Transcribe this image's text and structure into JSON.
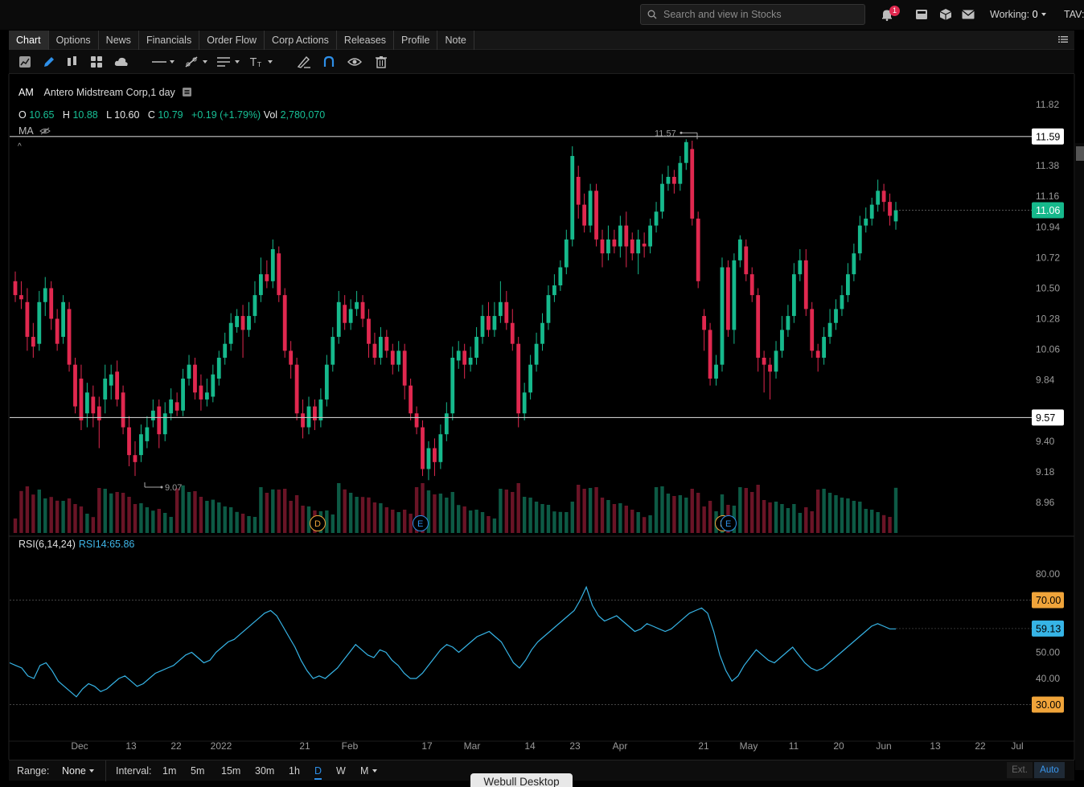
{
  "topbar": {
    "search_placeholder": "Search and view in Stocks",
    "notification_count": "1",
    "working_label": "Working:",
    "working_value": "0",
    "account_label": "TAV:"
  },
  "tabs": [
    {
      "label": "Chart",
      "active": true
    },
    {
      "label": "Options"
    },
    {
      "label": "News"
    },
    {
      "label": "Financials"
    },
    {
      "label": "Order Flow"
    },
    {
      "label": "Corp Actions"
    },
    {
      "label": "Releases"
    },
    {
      "label": "Profile"
    },
    {
      "label": "Note"
    }
  ],
  "legend": {
    "symbol": "AM",
    "name": "Antero Midstream Corp,1 day",
    "open_label": "O",
    "open": "10.65",
    "high_label": "H",
    "high": "10.88",
    "low_label": "L",
    "low": "10.60",
    "close_label": "C",
    "close": "10.79",
    "change": "+0.19 (+1.79%)",
    "vol_label": "Vol",
    "volume": "2,780,070",
    "ma_label": "MA",
    "rsi_label": "RSI(6,14,24)",
    "rsi_value": "RSI14:65.86"
  },
  "colors": {
    "up": "#16b98c",
    "down": "#e0284f",
    "rsi_line": "#36b4e6",
    "accent_blue": "#2e8fe8",
    "badge_orange": "#f0a43a"
  },
  "bottom": {
    "range_label": "Range:",
    "range_value": "None",
    "interval_label": "Interval:",
    "intervals": [
      "1m",
      "5m",
      "15m",
      "30m",
      "1h",
      "D",
      "W",
      "M"
    ],
    "active_interval": "D",
    "ext_label": "Ext.",
    "auto_label": "Auto"
  },
  "tooltip": "Webull Desktop",
  "chart_data": {
    "type": "candlestick",
    "price_axis": [
      "11.82",
      "11.38",
      "11.16",
      "10.94",
      "10.72",
      "10.50",
      "10.28",
      "10.06",
      "9.84",
      "9.40",
      "9.18",
      "8.96"
    ],
    "price_range": [
      8.88,
      11.9
    ],
    "horizontal_lines": [
      {
        "value": 11.59,
        "label": "11.59"
      },
      {
        "value": 9.57,
        "label": "9.57"
      }
    ],
    "last_price": {
      "value": 11.06,
      "label": "11.06"
    },
    "annotations": [
      {
        "value": 11.57,
        "label": "11.57"
      },
      {
        "value": 9.07,
        "label": "9.07"
      }
    ],
    "events": [
      "D",
      "E",
      "D",
      "E"
    ],
    "x_axis": [
      "Dec",
      "13",
      "22",
      "2022",
      "21",
      "Feb",
      "17",
      "Mar",
      "14",
      "23",
      "Apr",
      "21",
      "May",
      "11",
      "20",
      "Jun",
      "13",
      "22",
      "Jul"
    ],
    "candles": [
      [
        10.55,
        10.45,
        10.62,
        10.4
      ],
      [
        10.45,
        10.42,
        10.55,
        10.35
      ],
      [
        10.4,
        10.15,
        10.5,
        10.05
      ],
      [
        10.15,
        10.08,
        10.25,
        10.0
      ],
      [
        10.1,
        10.4,
        10.48,
        10.05
      ],
      [
        10.4,
        10.5,
        10.58,
        10.3
      ],
      [
        10.5,
        10.28,
        10.55,
        10.2
      ],
      [
        10.28,
        10.1,
        10.35,
        10.05
      ],
      [
        10.15,
        10.4,
        10.45,
        10.1
      ],
      [
        10.35,
        9.95,
        10.4,
        9.9
      ],
      [
        9.95,
        9.65,
        10.0,
        9.6
      ],
      [
        9.85,
        9.55,
        9.95,
        9.48
      ],
      [
        9.6,
        9.75,
        9.82,
        9.5
      ],
      [
        9.72,
        9.6,
        9.8,
        9.5
      ],
      [
        9.65,
        9.55,
        9.72,
        9.35
      ],
      [
        9.7,
        9.85,
        9.95,
        9.6
      ],
      [
        9.8,
        9.88,
        9.95,
        9.7
      ],
      [
        9.9,
        9.7,
        9.98,
        9.65
      ],
      [
        9.75,
        9.5,
        9.8,
        9.45
      ],
      [
        9.5,
        9.3,
        9.58,
        9.22
      ],
      [
        9.3,
        9.25,
        9.4,
        9.15
      ],
      [
        9.3,
        9.45,
        9.52,
        9.25
      ],
      [
        9.4,
        9.5,
        9.58,
        9.35
      ],
      [
        9.55,
        9.62,
        9.7,
        9.5
      ],
      [
        9.65,
        9.45,
        9.7,
        9.35
      ],
      [
        9.45,
        9.6,
        9.68,
        9.4
      ],
      [
        9.6,
        9.7,
        9.78,
        9.55
      ],
      [
        9.68,
        9.62,
        9.75,
        9.58
      ],
      [
        9.62,
        9.85,
        9.92,
        9.58
      ],
      [
        9.85,
        9.95,
        10.02,
        9.8
      ],
      [
        9.95,
        9.75,
        10.0,
        9.7
      ],
      [
        9.8,
        9.7,
        9.88,
        9.62
      ],
      [
        9.7,
        9.75,
        9.85,
        9.65
      ],
      [
        9.72,
        9.88,
        9.95,
        9.68
      ],
      [
        9.85,
        10.0,
        10.05,
        9.8
      ],
      [
        10.0,
        10.1,
        10.18,
        9.95
      ],
      [
        10.1,
        10.25,
        10.32,
        10.05
      ],
      [
        10.22,
        10.3,
        10.35,
        10.18
      ],
      [
        10.3,
        10.2,
        10.38,
        10.0
      ],
      [
        10.2,
        10.3,
        10.4,
        10.15
      ],
      [
        10.3,
        10.45,
        10.55,
        10.25
      ],
      [
        10.45,
        10.6,
        10.72,
        10.4
      ],
      [
        10.6,
        10.55,
        10.7,
        10.5
      ],
      [
        10.55,
        10.78,
        10.85,
        10.5
      ],
      [
        10.75,
        10.45,
        10.8,
        10.4
      ],
      [
        10.45,
        10.05,
        10.5,
        10.0
      ],
      [
        10.05,
        9.95,
        10.12,
        9.85
      ],
      [
        9.95,
        9.6,
        10.0,
        9.55
      ],
      [
        9.6,
        9.5,
        9.7,
        9.42
      ],
      [
        9.5,
        9.65,
        9.72,
        9.45
      ],
      [
        9.65,
        9.55,
        9.7,
        9.48
      ],
      [
        9.55,
        9.7,
        9.78,
        9.5
      ],
      [
        9.7,
        9.95,
        10.02,
        9.65
      ],
      [
        9.95,
        10.15,
        10.22,
        9.9
      ],
      [
        10.15,
        10.4,
        10.48,
        10.1
      ],
      [
        10.38,
        10.25,
        10.45,
        10.2
      ],
      [
        10.25,
        10.35,
        10.42,
        10.2
      ],
      [
        10.35,
        10.4,
        10.48,
        10.3
      ],
      [
        10.4,
        10.28,
        10.45,
        10.22
      ],
      [
        10.28,
        10.1,
        10.35,
        10.0
      ],
      [
        10.1,
        10.0,
        10.18,
        9.95
      ],
      [
        10.0,
        10.15,
        10.22,
        9.95
      ],
      [
        10.15,
        10.05,
        10.2,
        10.0
      ],
      [
        10.05,
        9.95,
        10.1,
        9.88
      ],
      [
        9.95,
        10.05,
        10.12,
        9.9
      ],
      [
        10.05,
        9.8,
        10.1,
        9.7
      ],
      [
        9.8,
        9.6,
        9.85,
        9.55
      ],
      [
        9.6,
        9.5,
        9.65,
        9.45
      ],
      [
        9.5,
        9.2,
        9.55,
        9.15
      ],
      [
        9.2,
        9.35,
        9.4,
        9.12
      ],
      [
        9.35,
        9.25,
        9.42,
        9.15
      ],
      [
        9.25,
        9.45,
        9.52,
        9.2
      ],
      [
        9.45,
        9.6,
        9.68,
        9.4
      ],
      [
        9.6,
        10.0,
        10.08,
        9.55
      ],
      [
        9.98,
        10.05,
        10.12,
        9.92
      ],
      [
        10.05,
        9.95,
        10.1,
        9.85
      ],
      [
        9.95,
        10.0,
        10.08,
        9.9
      ],
      [
        10.0,
        10.15,
        10.22,
        9.95
      ],
      [
        10.15,
        10.3,
        10.38,
        10.1
      ],
      [
        10.3,
        10.2,
        10.4,
        10.15
      ],
      [
        10.2,
        10.3,
        10.4,
        10.15
      ],
      [
        10.3,
        10.4,
        10.55,
        10.25
      ],
      [
        10.4,
        10.25,
        10.48,
        10.2
      ],
      [
        10.25,
        10.1,
        10.35,
        10.05
      ],
      [
        10.1,
        9.6,
        10.15,
        9.5
      ],
      [
        9.6,
        9.75,
        9.82,
        9.55
      ],
      [
        9.75,
        9.95,
        10.02,
        9.7
      ],
      [
        9.95,
        10.1,
        10.18,
        9.9
      ],
      [
        10.1,
        10.25,
        10.32,
        10.05
      ],
      [
        10.25,
        10.45,
        10.52,
        10.2
      ],
      [
        10.45,
        10.52,
        10.6,
        10.4
      ],
      [
        10.52,
        10.65,
        10.7,
        10.48
      ],
      [
        10.65,
        10.85,
        10.92,
        10.6
      ],
      [
        10.85,
        11.45,
        11.52,
        10.8
      ],
      [
        11.3,
        11.1,
        11.38,
        11.0
      ],
      [
        11.1,
        10.95,
        11.18,
        10.9
      ],
      [
        10.95,
        11.2,
        11.25,
        10.9
      ],
      [
        11.2,
        10.85,
        11.25,
        10.8
      ],
      [
        10.85,
        10.75,
        10.92,
        10.65
      ],
      [
        10.75,
        10.85,
        10.95,
        10.7
      ],
      [
        10.85,
        10.8,
        10.92,
        10.75
      ],
      [
        10.8,
        10.95,
        11.02,
        10.72
      ],
      [
        10.95,
        10.8,
        11.05,
        10.65
      ],
      [
        10.85,
        10.75,
        10.9,
        10.7
      ],
      [
        10.75,
        10.85,
        10.92,
        10.6
      ],
      [
        10.82,
        10.8,
        10.9,
        10.72
      ],
      [
        10.8,
        10.95,
        11.0,
        10.75
      ],
      [
        10.95,
        11.05,
        11.12,
        10.9
      ],
      [
        11.05,
        11.25,
        11.32,
        11.0
      ],
      [
        11.25,
        11.3,
        11.38,
        11.2
      ],
      [
        11.3,
        11.25,
        11.35,
        11.18
      ],
      [
        11.25,
        11.4,
        11.45,
        11.2
      ],
      [
        11.4,
        11.55,
        11.57,
        11.35
      ],
      [
        11.5,
        11.0,
        11.56,
        10.95
      ],
      [
        11.0,
        10.55,
        11.05,
        10.5
      ],
      [
        10.3,
        10.2,
        10.35,
        10.05
      ],
      [
        10.2,
        9.85,
        10.25,
        9.8
      ],
      [
        9.85,
        9.95,
        10.02,
        9.8
      ],
      [
        9.95,
        10.65,
        10.72,
        9.9
      ],
      [
        10.65,
        10.2,
        10.7,
        10.15
      ],
      [
        10.2,
        10.7,
        10.75,
        10.1
      ],
      [
        10.7,
        10.85,
        10.88,
        10.65
      ],
      [
        10.8,
        10.6,
        10.85,
        10.55
      ],
      [
        10.6,
        10.45,
        10.65,
        10.4
      ],
      [
        10.45,
        10.0,
        10.5,
        9.9
      ],
      [
        10.0,
        9.95,
        10.05,
        9.75
      ],
      [
        9.95,
        9.9,
        10.0,
        9.7
      ],
      [
        9.9,
        10.05,
        10.12,
        9.85
      ],
      [
        10.05,
        10.2,
        10.3,
        10.0
      ],
      [
        10.2,
        10.3,
        10.38,
        10.15
      ],
      [
        10.3,
        10.6,
        10.68,
        10.25
      ],
      [
        10.6,
        10.7,
        10.78,
        10.55
      ],
      [
        10.7,
        10.35,
        10.78,
        10.3
      ],
      [
        10.35,
        10.05,
        10.4,
        10.0
      ],
      [
        10.05,
        10.0,
        10.1,
        9.9
      ],
      [
        10.0,
        10.15,
        10.22,
        9.95
      ],
      [
        10.15,
        10.25,
        10.35,
        10.1
      ],
      [
        10.25,
        10.35,
        10.42,
        10.2
      ],
      [
        10.35,
        10.45,
        10.52,
        10.3
      ],
      [
        10.45,
        10.6,
        10.68,
        10.4
      ],
      [
        10.6,
        10.75,
        10.82,
        10.55
      ],
      [
        10.75,
        10.95,
        11.02,
        10.7
      ],
      [
        10.95,
        11.0,
        11.08,
        10.9
      ],
      [
        11.0,
        11.1,
        11.15,
        10.95
      ],
      [
        11.1,
        11.2,
        11.28,
        11.05
      ],
      [
        11.2,
        11.12,
        11.25,
        11.05
      ],
      [
        11.12,
        11.02,
        11.18,
        10.95
      ],
      [
        10.98,
        11.06,
        11.12,
        10.92
      ]
    ],
    "rsi_axis": [
      "80.00",
      "50.00",
      "40.00"
    ],
    "rsi_range": [
      26,
      83
    ],
    "rsi_levels": [
      {
        "value": 70,
        "label": "70.00"
      },
      {
        "value": 30,
        "label": "30.00"
      }
    ],
    "rsi_last": {
      "value": 59.13,
      "label": "59.13"
    },
    "rsi_values": [
      46,
      45,
      44,
      41,
      40,
      45,
      46,
      43,
      39,
      37,
      35,
      33,
      36,
      38,
      37,
      35,
      36,
      38,
      40,
      41,
      39,
      37,
      38,
      40,
      42,
      43,
      44,
      45,
      47,
      49,
      50,
      48,
      46,
      47,
      50,
      52,
      54,
      55,
      57,
      59,
      61,
      63,
      65,
      66,
      64,
      60,
      56,
      52,
      47,
      43,
      40,
      41,
      40,
      42,
      44,
      47,
      50,
      53,
      51,
      49,
      48,
      51,
      50,
      47,
      45,
      42,
      40,
      40,
      42,
      45,
      48,
      51,
      53,
      52,
      50,
      52,
      54,
      56,
      57,
      58,
      56,
      54,
      50,
      46,
      44,
      47,
      51,
      54,
      56,
      58,
      60,
      62,
      64,
      66,
      70,
      75,
      68,
      64,
      62,
      63,
      64,
      62,
      60,
      58,
      59,
      61,
      60,
      59,
      58,
      59,
      61,
      63,
      65,
      66,
      67,
      65,
      58,
      49,
      43,
      39,
      41,
      45,
      48,
      51,
      49,
      47,
      46,
      48,
      50,
      52,
      49,
      46,
      44,
      43,
      44,
      46,
      48,
      50,
      52,
      54,
      56,
      58,
      60,
      61,
      60,
      59,
      59
    ]
  }
}
